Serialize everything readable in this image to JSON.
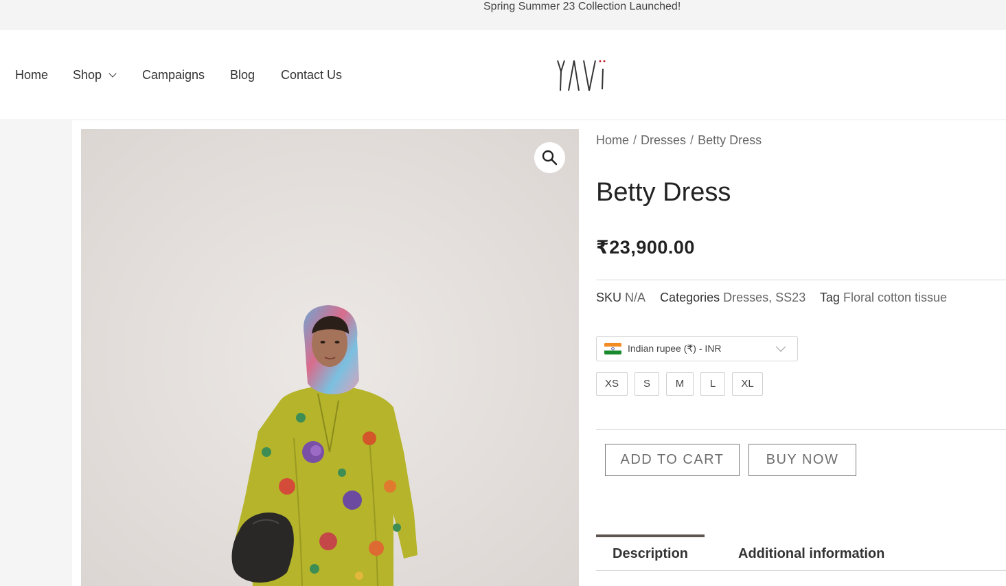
{
  "announcement": {
    "text": "Spring Summer 23 Collection Launched!"
  },
  "nav": {
    "items": [
      {
        "label": "Home"
      },
      {
        "label": "Shop"
      },
      {
        "label": "Campaigns"
      },
      {
        "label": "Blog"
      },
      {
        "label": "Contact Us"
      }
    ]
  },
  "brand": {
    "logo_text": "YAVi"
  },
  "breadcrumb": {
    "items": [
      "Home",
      "Dresses",
      "Betty Dress"
    ],
    "separator": "/"
  },
  "product": {
    "title": "Betty Dress",
    "price": "₹23,900.00",
    "sku_label": "SKU",
    "sku_value": "N/A",
    "categories_label": "Categories",
    "categories": [
      "Dresses",
      "SS23"
    ],
    "categories_separator": ",",
    "tag_label": "Tag",
    "tag_value": "Floral cotton tissue"
  },
  "currency": {
    "selected": "Indian rupee (₹) - INR",
    "flag_icon": "india-flag-icon"
  },
  "sizes": [
    "XS",
    "S",
    "M",
    "L",
    "XL"
  ],
  "actions": {
    "add_to_cart": "ADD TO CART",
    "buy_now": "BUY NOW"
  },
  "tabs": [
    {
      "label": "Description",
      "active": true
    },
    {
      "label": "Additional information",
      "active": false
    }
  ],
  "colors": {
    "announcement_bg": "#f4f4f4",
    "tab_active": "#5e5550",
    "logo_accent": "#c1121f"
  }
}
